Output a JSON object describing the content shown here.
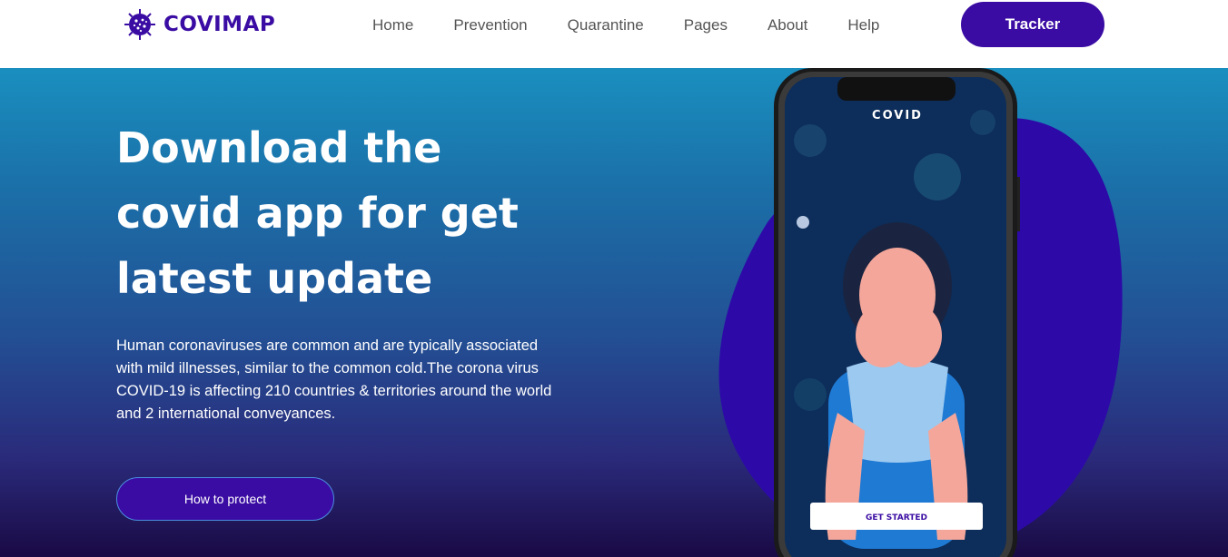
{
  "brand": {
    "name": "COVIMAP",
    "color": "#3a0ca3"
  },
  "nav": {
    "links": [
      "Home",
      "Prevention",
      "Quarantine",
      "Pages",
      "About",
      "Help"
    ],
    "cta_label": "Tracker"
  },
  "hero": {
    "title": "Download the covid app for get latest update",
    "description": "Human coronaviruses are common and are typically associated with mild illnesses, similar to the common cold.The corona virus COVID-19 is affecting 210 countries & territories around the world and 2 international conveyances.",
    "button_label": "How to protect"
  },
  "phone": {
    "app_title": "COVID",
    "button_label": "GET STARTED"
  },
  "icons": [
    "virus-logo-icon"
  ]
}
